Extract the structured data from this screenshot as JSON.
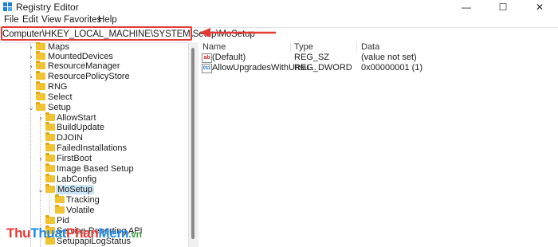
{
  "window": {
    "title": "Registry Editor",
    "controls": {
      "minimize": "—",
      "maximize": "☐",
      "close": "✕"
    }
  },
  "menu": [
    "File",
    "Edit",
    "View",
    "Favorites",
    "Help"
  ],
  "address": "Computer\\HKEY_LOCAL_MACHINE\\SYSTEM\\Setup\\MoSetup",
  "tree": [
    {
      "label": "Maps"
    },
    {
      "label": "MountedDevices"
    },
    {
      "label": "ResourceManager"
    },
    {
      "label": "ResourcePolicyStore"
    },
    {
      "label": "RNG"
    },
    {
      "label": "Select"
    },
    {
      "label": "Setup"
    },
    {
      "label": "AllowStart"
    },
    {
      "label": "BuildUpdate"
    },
    {
      "label": "DJOIN"
    },
    {
      "label": "FailedInstallations"
    },
    {
      "label": "FirstBoot"
    },
    {
      "label": "Image Based Setup"
    },
    {
      "label": "LabConfig"
    },
    {
      "label": "MoSetup"
    },
    {
      "label": "Tracking"
    },
    {
      "label": "Volatile"
    },
    {
      "label": "Pid"
    },
    {
      "label": "Service Reporting API"
    },
    {
      "label": "SetupapiLogStatus"
    }
  ],
  "columns": {
    "name": "Name",
    "type": "Type",
    "data": "Data"
  },
  "values": [
    {
      "name": "(Default)",
      "type": "REG_SZ",
      "data": "(value not set)",
      "icon": "ab"
    },
    {
      "name": "AllowUpgradesWithUnsu...",
      "type": "REG_DWORD",
      "data": "0x00000001 (1)",
      "icon": "011"
    }
  ],
  "watermark": {
    "parts": [
      "Thu",
      "Thuat",
      "Phan",
      "Mem",
      ".vn"
    ],
    "colors": {
      "thu": "#e53935",
      "thuat": "#1e88e5",
      "phan": "#e53935",
      "mem": "#1e88e5",
      "vn": "#43a047"
    }
  },
  "accent": {
    "highlight_box": "#e53935",
    "selected_row": "#cce4f7"
  }
}
